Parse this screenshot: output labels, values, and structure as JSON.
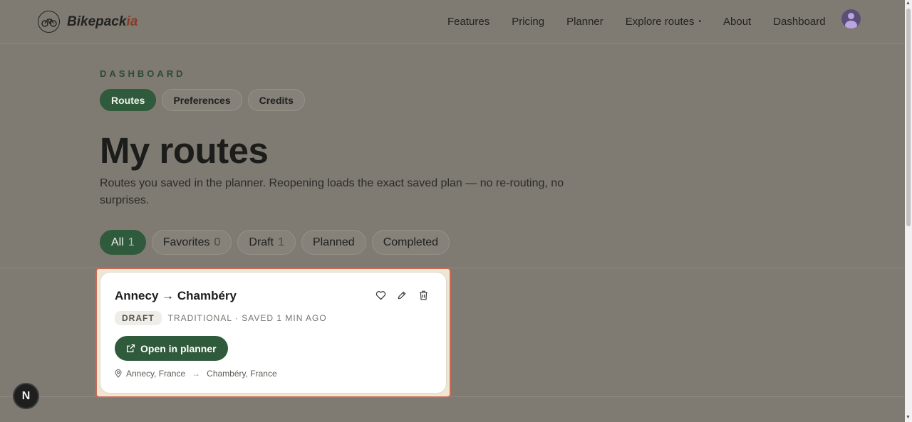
{
  "brand": {
    "name_main": "Bikepack",
    "name_accent": "ia"
  },
  "nav": {
    "items": [
      {
        "label": "Features"
      },
      {
        "label": "Pricing"
      },
      {
        "label": "Planner"
      },
      {
        "label": "Explore routes",
        "suffix": "•"
      },
      {
        "label": "About"
      },
      {
        "label": "Dashboard"
      }
    ]
  },
  "dashboard": {
    "eyebrow": "DASHBOARD",
    "tabs": [
      {
        "label": "Routes",
        "active": true
      },
      {
        "label": "Preferences",
        "active": false
      },
      {
        "label": "Credits",
        "active": false
      }
    ],
    "title": "My routes",
    "subtitle": "Routes you saved in the planner. Reopening loads the exact saved plan — no re-routing, no surprises."
  },
  "filters": [
    {
      "label": "All",
      "count": "1",
      "active": true
    },
    {
      "label": "Favorites",
      "count": "0",
      "active": false
    },
    {
      "label": "Draft",
      "count": "1",
      "active": false
    },
    {
      "label": "Planned",
      "count": "",
      "active": false
    },
    {
      "label": "Completed",
      "count": "",
      "active": false
    }
  ],
  "route_card": {
    "title": "Annecy → Chambéry",
    "status_badge": "DRAFT",
    "meta": "TRADITIONAL · SAVED 1 MIN AGO",
    "open_button": "Open in planner",
    "start": "Annecy, France",
    "arrow": "→",
    "end": "Chambéry, France",
    "actions": [
      "heart-icon",
      "pencil-icon",
      "trash-icon"
    ]
  },
  "fab": {
    "label": "N"
  },
  "colors": {
    "accent_green": "#2f5a3b",
    "brand_accent": "#8a3a22",
    "card_highlight": "#c96a55"
  }
}
